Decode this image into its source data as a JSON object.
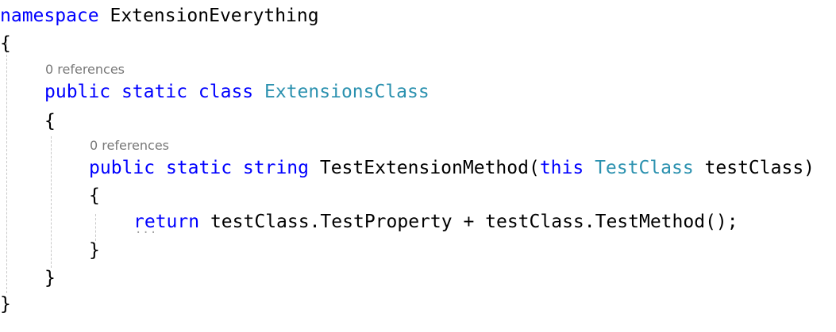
{
  "code": {
    "ns_keyword": "namespace",
    "ns_name": "ExtensionEverything",
    "open_brace": "{",
    "close_brace": "}",
    "class_lens": "0 references",
    "class_kw_public": "public",
    "class_kw_static": "static",
    "class_kw_class": "class",
    "class_name": "ExtensionsClass",
    "method_lens": "0 references",
    "method_kw_public": "public",
    "method_kw_static": "static",
    "method_kw_string": "string",
    "method_name": "TestExtensionMethod(",
    "method_kw_this": "this",
    "param_type": "TestClass",
    "param_name": "testClass)",
    "return_kw": "return",
    "return_expr": "testClass.TestProperty + testClass.TestMethod();"
  },
  "colors": {
    "keyword": "#0000ff",
    "type": "#2b91af",
    "plain": "#000000",
    "codelens": "#777777",
    "guide": "#c8c8c8"
  }
}
